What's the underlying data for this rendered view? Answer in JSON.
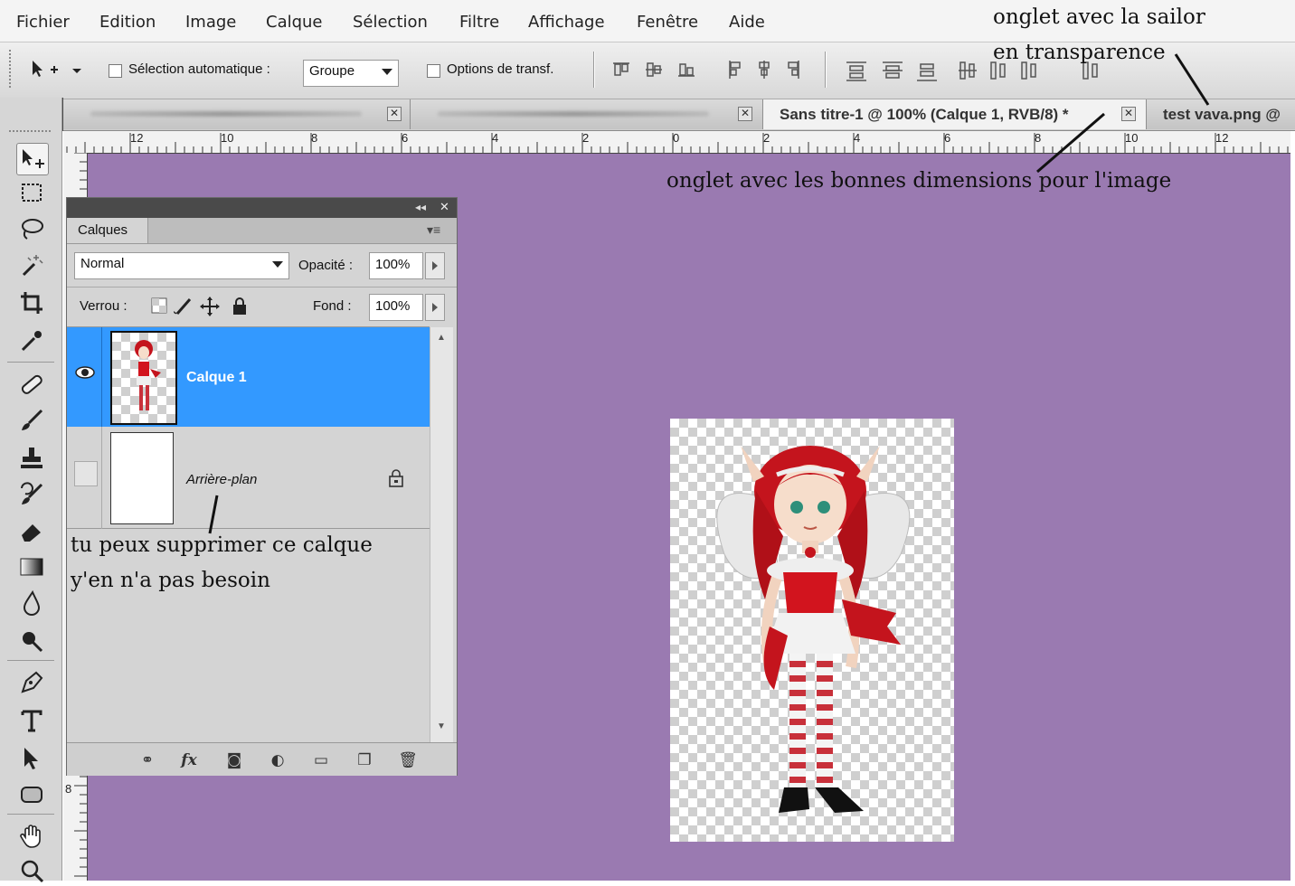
{
  "menubar": {
    "items": [
      "Fichier",
      "Edition",
      "Image",
      "Calque",
      "Sélection",
      "Filtre",
      "Affichage",
      "Fenêtre",
      "Aide"
    ]
  },
  "options_bar": {
    "auto_select_label": "Sélection automatique :",
    "auto_select_value": "Groupe",
    "transform_options_label": "Options de transf."
  },
  "tabs": [
    {
      "label": "",
      "active": false
    },
    {
      "label": "",
      "active": false
    },
    {
      "label": "Sans titre-1 @ 100% (Calque 1, RVB/8) *",
      "active": true
    },
    {
      "label": "test vava.png @",
      "active": false
    }
  ],
  "tab_close_glyph": "✕",
  "ruler": {
    "h_numbers": [
      "12",
      "10",
      "8",
      "6",
      "4",
      "2",
      "0",
      "2",
      "4",
      "6",
      "8",
      "10",
      "12"
    ],
    "v_numbers": [
      "8"
    ]
  },
  "layers_panel": {
    "tab_label": "Calques",
    "blend_mode": "Normal",
    "opacity_label": "Opacité :",
    "opacity_value": "100%",
    "lock_label": "Verrou :",
    "fill_label": "Fond :",
    "fill_value": "100%",
    "layers": [
      {
        "name": "Calque 1",
        "selected": true,
        "visible": true
      },
      {
        "name": "Arrière-plan",
        "selected": false,
        "visible": false,
        "locked": true
      }
    ]
  },
  "annotations": {
    "sailor_tab_line1": "onglet avec la sailor",
    "sailor_tab_line2": "en transparence",
    "dimensions_tab": "onglet avec les bonnes dimensions pour l'image",
    "delete_layer_line1": "tu peux supprimer ce calque",
    "delete_layer_line2": "y'en n'a pas besoin"
  },
  "colors": {
    "canvas_bg": "#9a7ab1",
    "selected_layer": "#3399ff"
  }
}
